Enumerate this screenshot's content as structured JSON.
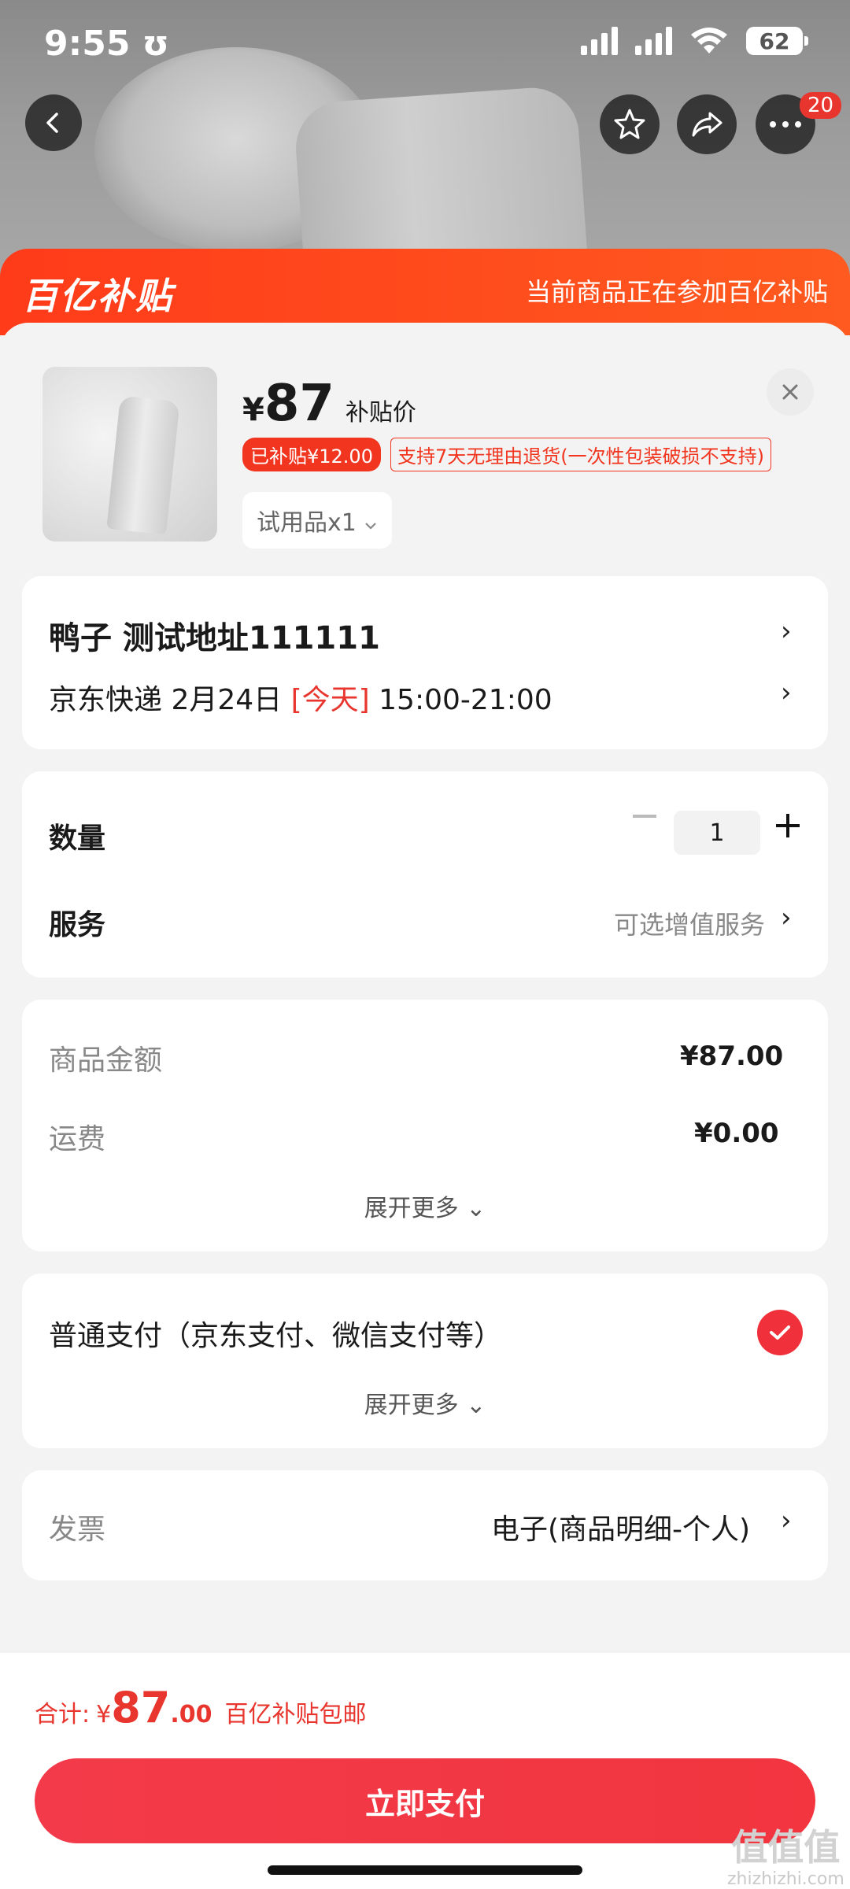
{
  "status_bar": {
    "time": "9:55",
    "alarm_glyph": "ʊ",
    "battery": "62"
  },
  "nav": {
    "notification_count": "20"
  },
  "banner": {
    "logo": "百亿补贴",
    "note": "当前商品正在参加百亿补贴"
  },
  "product": {
    "currency": "¥",
    "price": "87",
    "price_label": "补贴价",
    "subsidy_tag": "已补贴¥12.00",
    "return_policy": "支持7天无理由退货(一次性包装破损不支持)",
    "variant": "试用品x1"
  },
  "address": {
    "name_line": "鸭子  测试地址111111",
    "shipping_carrier": "京东快递 2月24日 ",
    "shipping_today": "[今天]",
    "shipping_window": " 15:00-21:00"
  },
  "quantity": {
    "label": "数量",
    "value": "1"
  },
  "service": {
    "label": "服务",
    "value": "可选增值服务"
  },
  "cost": {
    "goods_label": "商品金额",
    "goods_value": "¥87.00",
    "shipping_label": "运费",
    "shipping_value": "¥0.00",
    "expand": "展开更多"
  },
  "payment": {
    "method": "普通支付（京东支付、微信支付等）",
    "expand": "展开更多"
  },
  "invoice": {
    "label": "发票",
    "value": "电子(商品明细-个人)"
  },
  "footer": {
    "total_label": "合计:",
    "currency": "¥",
    "total_int": "87",
    "total_dec": ".00",
    "note": "百亿补贴包邮",
    "pay_button": "立即支付"
  },
  "watermark": {
    "mark": "值值值",
    "site": "zhizhizhi.com"
  },
  "colors": {
    "accent": "#f2351f",
    "pay": "#f2353f",
    "banner": "#ff4a1c"
  },
  "icons": [
    "back-icon",
    "star-icon",
    "share-icon",
    "more-icon",
    "close-icon",
    "chevron-right-icon",
    "chevron-down-icon",
    "checkmark-icon",
    "plus-icon",
    "minus-icon"
  ]
}
